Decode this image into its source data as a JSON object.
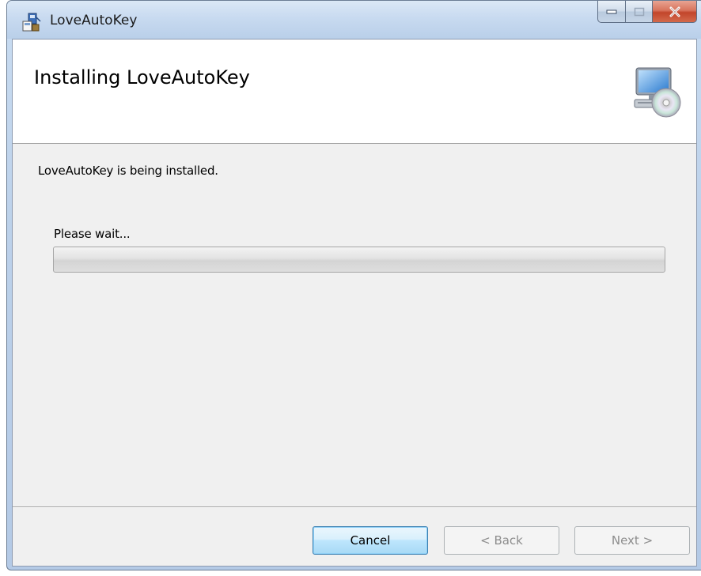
{
  "window": {
    "title": "LoveAutoKey",
    "controls": {
      "minimize_icon": "minimize-icon",
      "maximize_icon": "maximize-icon",
      "close_icon": "close-icon"
    }
  },
  "banner": {
    "title": "Installing LoveAutoKey",
    "icon": "computer-disc-icon"
  },
  "content": {
    "status": "LoveAutoKey is being installed.",
    "wait_label": "Please wait...",
    "progress_fraction": 0.0
  },
  "buttons": {
    "cancel": "Cancel",
    "back": "< Back",
    "next": "Next >"
  },
  "colors": {
    "close_button": "#c2452b",
    "focus_button_border": "#3c7fb1",
    "disabled_text": "#8d8d8d"
  }
}
